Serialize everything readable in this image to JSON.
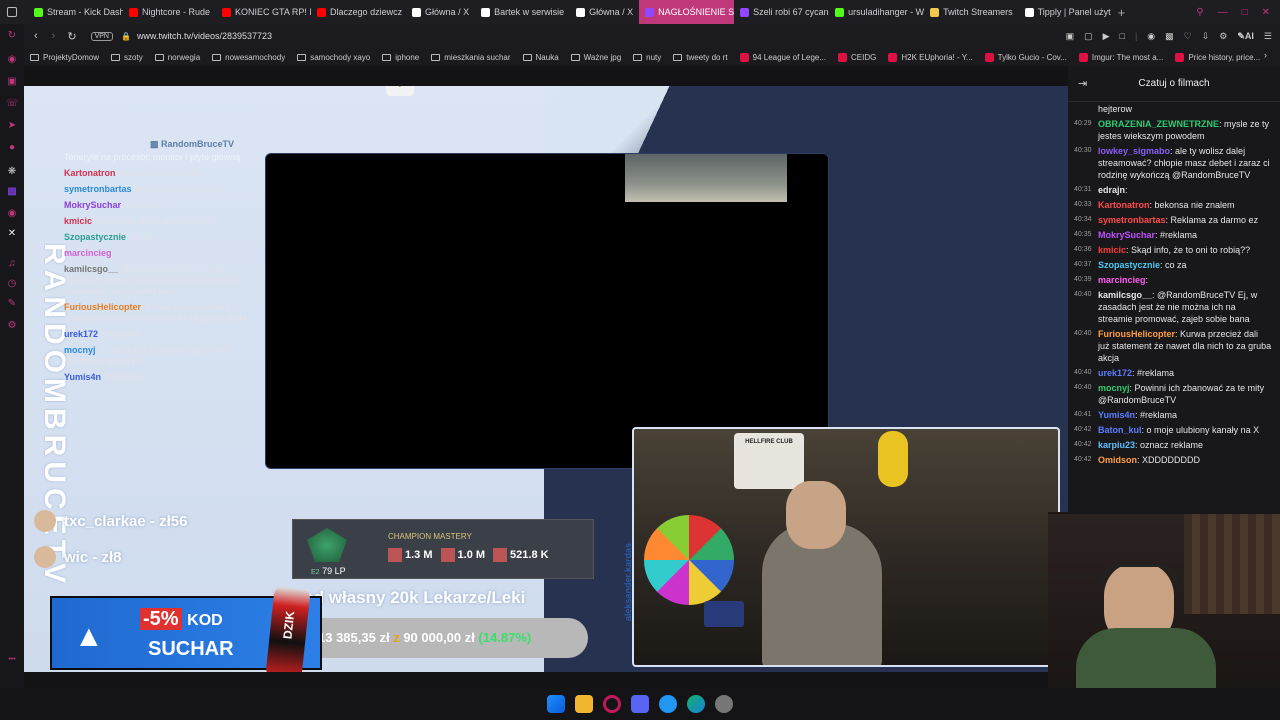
{
  "tabs": [
    {
      "label": "Stream - Kick Dash",
      "color": "#53fc18"
    },
    {
      "label": "Nightcore - Rude",
      "color": "#ff0000"
    },
    {
      "label": "KONIEC GTA RP! M",
      "color": "#ff0000"
    },
    {
      "label": "Dlaczego dziewcz",
      "color": "#ff0000"
    },
    {
      "label": "Główna / X",
      "color": "#ffffff"
    },
    {
      "label": "Bartek w serwisie",
      "color": "#ffffff"
    },
    {
      "label": "Główna / X",
      "color": "#ffffff"
    },
    {
      "label": "NAGŁOŚNIENIE SPRAWY",
      "color": "#9146ff",
      "active": true
    },
    {
      "label": "Szeli robi 67 cycan",
      "color": "#9146ff"
    },
    {
      "label": "ursuladihanger - W",
      "color": "#53fc18"
    },
    {
      "label": "Twitch Streamers",
      "color": "#f2c94c"
    },
    {
      "label": "Tipply | Panel użyt",
      "color": "#ffffff"
    }
  ],
  "nav": {
    "url": "www.twitch.tv/videos/2839537723",
    "vpn_label": "VPN",
    "ai_label": "AI"
  },
  "bookmarks": [
    {
      "label": "ProjektyDomow",
      "type": "folder"
    },
    {
      "label": "szoty",
      "type": "folder"
    },
    {
      "label": "norwegia",
      "type": "folder"
    },
    {
      "label": "nowesamochody",
      "type": "folder"
    },
    {
      "label": "samochody xayo",
      "type": "folder"
    },
    {
      "label": "iphone",
      "type": "folder"
    },
    {
      "label": "mieszkania suchar",
      "type": "folder"
    },
    {
      "label": "Nauka",
      "type": "folder"
    },
    {
      "label": "Ważne jpg",
      "type": "folder"
    },
    {
      "label": "nuty",
      "type": "folder"
    },
    {
      "label": "tweety do rt",
      "type": "folder"
    },
    {
      "label": "94 League of Lege...",
      "type": "site"
    },
    {
      "label": "CEIDG",
      "type": "site"
    },
    {
      "label": "H2K EUphoria! - Y...",
      "type": "site"
    },
    {
      "label": "Tylko Gucio - Cov...",
      "type": "site"
    },
    {
      "label": "Imgur: The most a...",
      "type": "site"
    },
    {
      "label": "Price history, price...",
      "type": "site"
    }
  ],
  "chat_header": "Czatuj o filmach",
  "chat": [
    {
      "time": "",
      "user": "",
      "user_color": "#e6e6e6",
      "text": "hejterow"
    },
    {
      "time": "40:29",
      "user": "OBRAZENIA_ZEWNETRZNE",
      "user_color": "#2ecc71",
      "text": ": mysle ze ty jestes wiekszym powodem"
    },
    {
      "time": "40:30",
      "user": "lowkey_sigmabo",
      "user_color": "#8a5cf6",
      "text": ": ale ty wolisz dalej streamować? chłopie masz debet i zaraz ci rodzinę wykończą @RandomBruceTV"
    },
    {
      "time": "40:31",
      "user": "edrajn",
      "user_color": "#e6e6e6",
      "text": ":"
    },
    {
      "time": "40:33",
      "user": "Kartonatron",
      "user_color": "#ff4b4b",
      "text": ": bekonsa nie znalem"
    },
    {
      "time": "40:34",
      "user": "symetronbartas",
      "user_color": "#ff4b4b",
      "text": ": Reklama za darmo ez"
    },
    {
      "time": "40:35",
      "user": "MokrySuchar",
      "user_color": "#c050ff",
      "text": ": #reklama"
    },
    {
      "time": "40:36",
      "user": "kmicic",
      "user_color": "#ff3b3b",
      "text": ": Skąd info, że to oni to robią??"
    },
    {
      "time": "40:37",
      "user": "Szopastycznie",
      "user_color": "#4cc9f0",
      "text": ": co za"
    },
    {
      "time": "40:39",
      "user": "marcincieg",
      "user_color": "#ff5cf0",
      "text": ":"
    },
    {
      "time": "40:40",
      "user": "kamilcsgo__",
      "user_color": "#e6e6e6",
      "text": ": @RandomBruceTV Ej, w zasadach jest że nie można ich na streamie promować, zajeb sobie bana"
    },
    {
      "time": "40:40",
      "user": "FuriousHelicopter",
      "user_color": "#ff9f43",
      "text": ": Kurwa przecież dali już statement że nawet dla nich to za gruba akcja"
    },
    {
      "time": "40:40",
      "user": "urek172",
      "user_color": "#5b7cff",
      "text": ": #reklama"
    },
    {
      "time": "40:40",
      "user": "mocnyj",
      "user_color": "#2ecc71",
      "text": ": Powinni ich zbanować za te mity @RandomBruceTV"
    },
    {
      "time": "40:41",
      "user": "Yumis4n",
      "user_color": "#5b7cff",
      "text": ": #reklama"
    },
    {
      "time": "40:42",
      "user": "Baton_kul",
      "user_color": "#5b7cff",
      "text": ": o moje ulubiony kanały na X"
    },
    {
      "time": "40:42",
      "user": "karpiu23",
      "user_color": "#5bc0ff",
      "text": ": oznacz reklame"
    },
    {
      "time": "40:42",
      "user": "Omidson",
      "user_color": "#ff9f43",
      "text": ": XDDDDDDDD"
    }
  ],
  "overlay": {
    "channel_tag": "RandomBruceTV",
    "vertical_name": "RANDOMBRUCETV",
    "side_text": "aleksander.kardas",
    "chat_top": "Teneryfe na procesor, monitor i płyte główną",
    "chat": [
      {
        "user": "Kartonatron",
        "user_color": "#d4314e",
        "text": ": bekonsa nie znalem"
      },
      {
        "user": "symetronbartas",
        "user_color": "#2b8ad8",
        "text": ": Reklama za darmo ez"
      },
      {
        "user": "MokrySuchar",
        "user_color": "#8a3fd9",
        "text": ": #reklama"
      },
      {
        "user": "kmicic",
        "user_color": "#d4314e",
        "text": ": Skąd info, że to oni to robią??"
      },
      {
        "user": "Szopastycznie",
        "user_color": "#2a9d8f",
        "text": ": co za"
      },
      {
        "user": "marcincieg",
        "user_color": "#d15fd1",
        "text": ":"
      },
      {
        "user": "kamilcsgo__",
        "user_color": "#777",
        "text": ": @RandomBruceTV Ej, w zasadach jest że nie można ich na streamie promować, zajeb sobie bana"
      },
      {
        "user": "FuriousHelicopter",
        "user_color": "#e67e22",
        "text": ": Kurwa przecież dali już statement że nawet dla nich to za gruba akcja"
      },
      {
        "user": "urek172",
        "user_color": "#3b5bdb",
        "text": ": #reklama"
      },
      {
        "user": "mocnyj",
        "user_color": "#2b8ad8",
        "text": ": Powinni ich zbanować za te mity @RandomBruceTV"
      },
      {
        "user": "Yumis4n",
        "user_color": "#3b5bdb",
        "text": ": #reklama"
      }
    ],
    "donations": [
      {
        "text": "txc_clarkae - zł56"
      },
      {
        "text": "wic - zł8"
      }
    ],
    "mastery": {
      "title": "CHAMPION MASTERY",
      "lp": "79 LP",
      "rank": "E2",
      "scores": [
        "1.3 M",
        "1.0 M",
        "521.8 K"
      ]
    },
    "goal": {
      "title": "Wkład własny 20k Lekarze/Leki",
      "current": "13 385,35 zł",
      "z": "z",
      "target": "90 000,00 zł",
      "percent": "(14.87%)",
      "progress": 0.1487
    },
    "promo": {
      "percent": "-5%",
      "kod": "KOD",
      "code": "SUCHAR",
      "brand": "DZIK"
    }
  },
  "webcam": {
    "club_text": "HELLFIRE CLUB"
  }
}
